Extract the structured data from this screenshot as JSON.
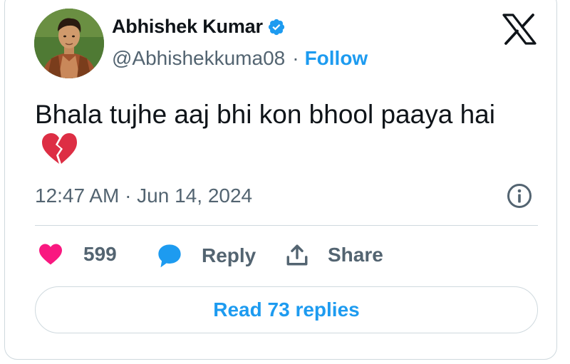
{
  "author": {
    "display_name": "Abhishek Kumar",
    "handle": "@Abhishekkuma08",
    "verified": true
  },
  "follow_label": "Follow",
  "separator": "·",
  "tweet": {
    "text": "Bhala tujhe aaj bhi kon bhool paaya hai",
    "emoji_icon": "broken-heart-icon",
    "timestamp": "12:47 AM · Jun 14, 2024"
  },
  "actions": {
    "likes_count": "599",
    "reply_label": "Reply",
    "share_label": "Share"
  },
  "read_replies_label": "Read 73 replies",
  "icons": {
    "logo": "x-logo",
    "verified": "verified-badge-icon",
    "info": "info-icon",
    "like": "heart-icon",
    "reply": "speech-bubble-icon",
    "share": "share-upload-icon"
  },
  "colors": {
    "accent": "#1d9bf0",
    "like": "#f91880",
    "text": "#0f1419",
    "muted": "#536471",
    "border": "#cfd9de"
  }
}
